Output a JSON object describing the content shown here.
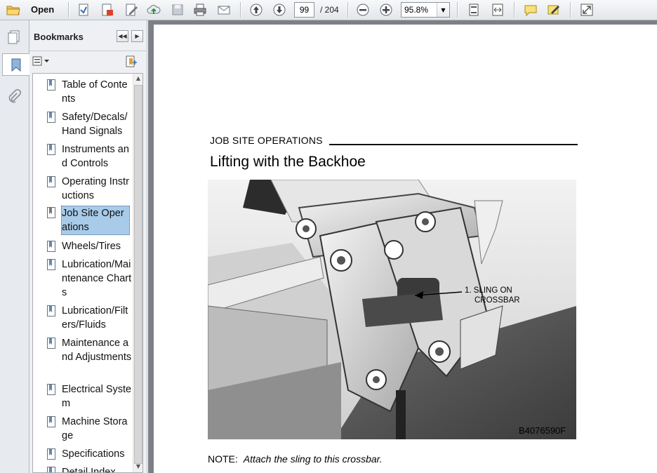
{
  "toolbar": {
    "open_label": "Open",
    "page_current": "99",
    "page_total": "/ 204",
    "zoom": "95.8%",
    "icons": [
      "folder-open-icon",
      "create-pdf-icon",
      "export-icon",
      "sign-icon",
      "upload-cloud-icon",
      "save-icon",
      "print-icon",
      "email-icon",
      "previous-page-icon",
      "next-page-icon",
      "zoom-out-icon",
      "zoom-in-icon",
      "fit-page-icon",
      "fit-width-icon",
      "comment-icon",
      "highlight-icon",
      "fullscreen-icon"
    ]
  },
  "bookmarks_panel": {
    "title": "Bookmarks",
    "items": [
      {
        "label": "Table of Contents"
      },
      {
        "label": "Safety/Decals/ Hand Signals"
      },
      {
        "label": "Instruments and Controls"
      },
      {
        "label": "Operating Instructions"
      },
      {
        "label": "Job Site Operations",
        "selected": true
      },
      {
        "label": "Wheels/Tires"
      },
      {
        "label": "Lubrication/Maintenance Charts"
      },
      {
        "label": "Lubrication/Filters/Fluids"
      },
      {
        "label": "Maintenance and Adjustments"
      },
      {
        "label": "Electrical System"
      },
      {
        "label": "Machine Storage"
      },
      {
        "label": "Specifications"
      },
      {
        "label": "Detail Index"
      }
    ]
  },
  "document": {
    "section_header": "JOB SITE OPERATIONS",
    "title": "Lifting with the Backhoe",
    "callout_line1": "1.  SLING ON",
    "callout_line2": "CROSSBAR",
    "figure_id": "B4076590F",
    "note_label": "NOTE:",
    "note_text": "Attach the sling to this crossbar."
  }
}
